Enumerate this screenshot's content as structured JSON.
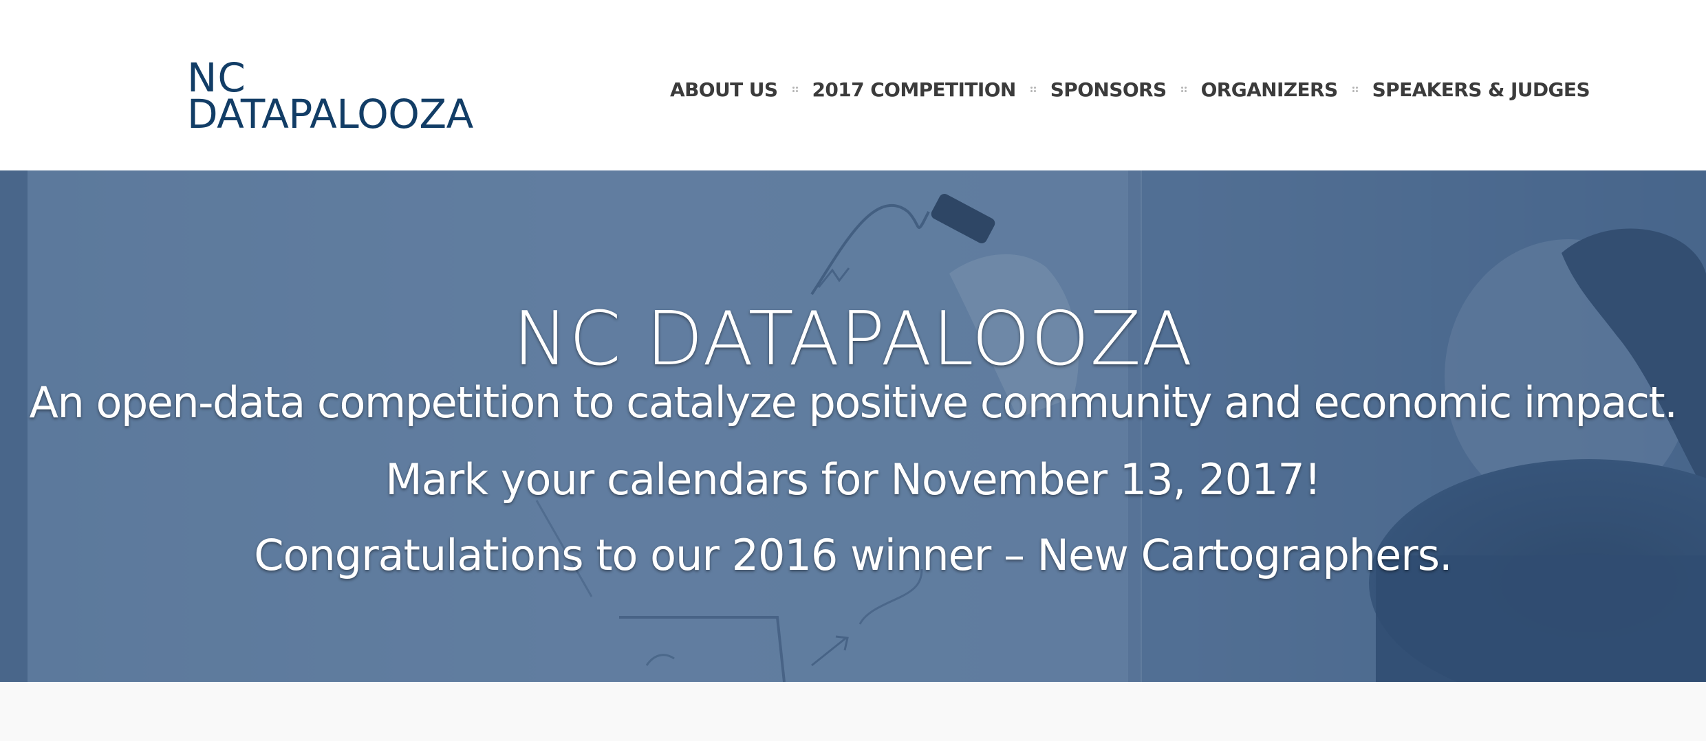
{
  "header": {
    "logo": {
      "line1": "NC",
      "line2": "DATAPALOOZA"
    },
    "nav": [
      {
        "label": "ABOUT US"
      },
      {
        "label": "2017 COMPETITION"
      },
      {
        "label": "SPONSORS"
      },
      {
        "label": "ORGANIZERS"
      },
      {
        "label": "SPEAKERS & JUDGES"
      }
    ]
  },
  "hero": {
    "title": "NC DATAPALOOZA",
    "subtitle": "An open-data competition to catalyze positive community and economic impact.",
    "date_line": "Mark your calendars for November 13, 2017!",
    "congrats_line": "Congratulations to our 2016 winner – New Cartographers."
  },
  "colors": {
    "logo": "#123d66",
    "nav_text": "#3b3b3b",
    "hero_overlay": "#345a87",
    "hero_text": "#ffffff",
    "below_bg": "#f9f9f9"
  }
}
